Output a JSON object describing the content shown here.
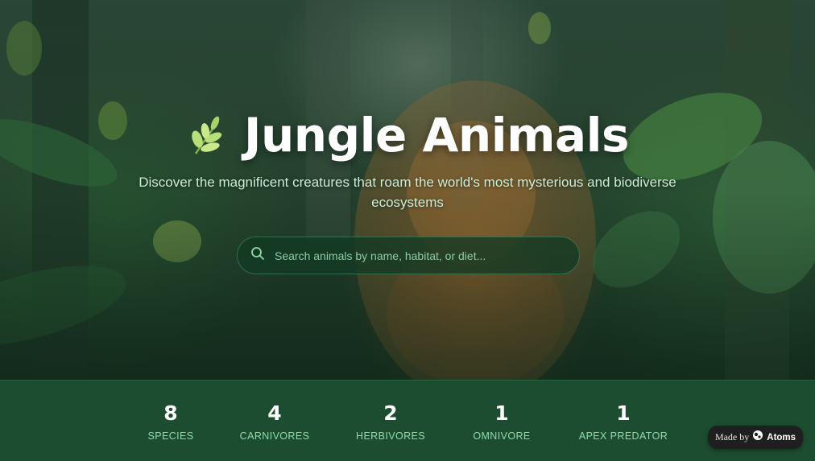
{
  "hero": {
    "title": "Jungle Animals",
    "title_icon": "leaf-icon",
    "subtitle": "Discover the magnificent creatures that roam the world's most mysterious and biodiverse ecosystems"
  },
  "search": {
    "icon": "search-icon",
    "placeholder": "Search animals by name, habitat, or diet...",
    "value": ""
  },
  "stats": [
    {
      "value": "8",
      "label": "SPECIES"
    },
    {
      "value": "4",
      "label": "CARNIVORES"
    },
    {
      "value": "2",
      "label": "HERBIVORES"
    },
    {
      "value": "1",
      "label": "OMNIVORE"
    },
    {
      "value": "1",
      "label": "APEX PREDATOR"
    }
  ],
  "badge": {
    "made_by": "Made by",
    "brand": "Atoms",
    "icon": "atoms-logo-icon"
  },
  "colors": {
    "stats_background": "#1d4d31",
    "stat_label": "#8fdca8",
    "subtitle": "#cdeed6",
    "leaf_accent": "#b7e07a"
  }
}
